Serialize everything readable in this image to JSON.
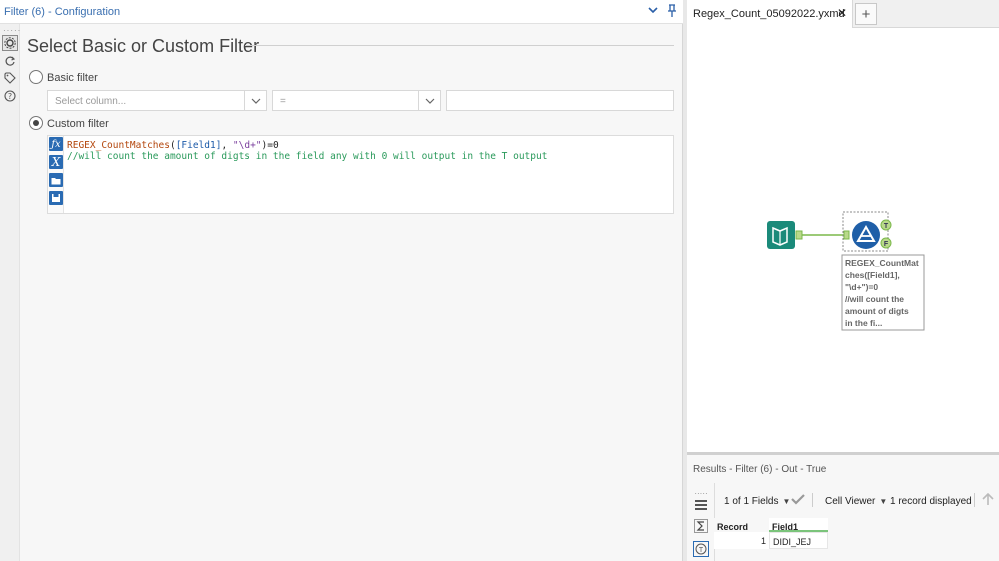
{
  "config": {
    "title": "Filter (6) - Configuration",
    "section_title": "Select Basic or Custom Filter",
    "basic_filter_label": "Basic filter",
    "custom_filter_label": "Custom filter",
    "column_placeholder": "Select column...",
    "operator_value": "=",
    "value_field": "",
    "selected_mode": "custom",
    "expression": {
      "fn": "REGEX_CountMatches",
      "field": "[Field1]",
      "pattern": "\"\\d+\"",
      "tail": ")=0",
      "comment": "//will count the amount of digts in the field any with 0 will output in the T output"
    },
    "expression_buttons": [
      "fx-icon",
      "variable-icon",
      "open-folder-icon",
      "save-icon"
    ]
  },
  "canvas": {
    "tab_label": "Regex_Count_05092022.yxmd",
    "close_glyph": "✕",
    "add_glyph": "+",
    "filter_annotation": [
      "REGEX_CountMat",
      "ches([Field1],",
      "\"\\d+\")=0",
      "//will count the",
      "amount of digts",
      "in the fi..."
    ],
    "output_true": "T",
    "output_false": "F"
  },
  "results": {
    "title": "Results - Filter (6) - Out - True",
    "fields_selector": "1 of 1 Fields",
    "viewer": "Cell Viewer",
    "record_count": "1 record displayed",
    "columns": [
      "Record",
      "Field1"
    ],
    "rows": [
      [
        "1",
        "DIDI_JEJ"
      ]
    ]
  },
  "colors": {
    "accent_blue": "#2a6bb3",
    "input_tool_teal": "#1b8a7a",
    "filter_tool_blue": "#1f5fa8",
    "connection_green": "#7bb84a",
    "comment_green": "#2a9a5b"
  }
}
